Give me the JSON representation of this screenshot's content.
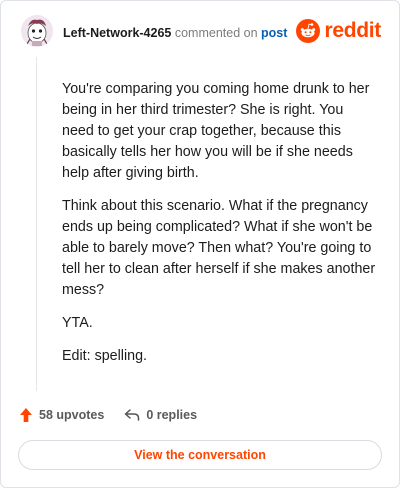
{
  "header": {
    "username": "Left-Network-4265",
    "commented_on": "commented on",
    "post_link": "post",
    "brand": "reddit"
  },
  "comment": {
    "paragraphs": [
      "You're comparing you coming home drunk to her being in her third trimester? She is right. You need to get your crap together, because this basically tells her how you will be if she needs help after giving birth.",
      "Think about this scenario. What if the pregnancy ends up being complicated? What if she won't be able to barely move? Then what? You're going to tell her to clean after herself if she makes another mess?",
      "YTA.",
      "Edit: spelling."
    ]
  },
  "actions": {
    "upvotes": "58 upvotes",
    "replies": "0 replies"
  },
  "cta": {
    "label": "View the conversation"
  },
  "colors": {
    "brand": "#ff4500",
    "link": "#0b5fb5"
  },
  "icons": [
    "avatar",
    "reddit-logo-icon",
    "upvote-arrow-icon",
    "reply-arrow-icon"
  ]
}
